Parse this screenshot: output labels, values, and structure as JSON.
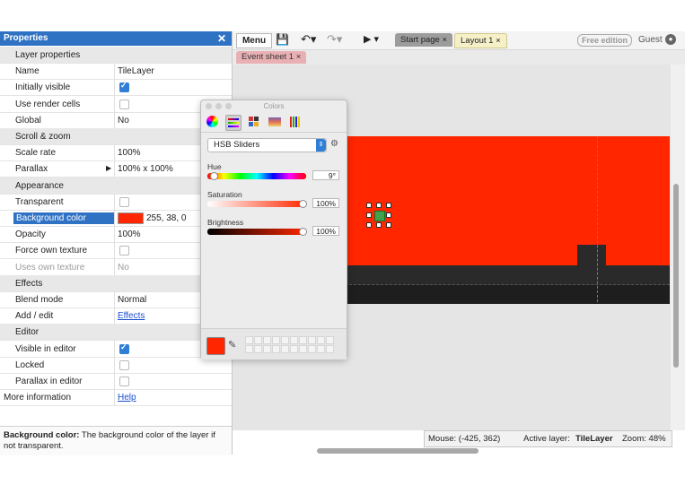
{
  "properties": {
    "title": "Properties",
    "close": "✕",
    "rows": [
      {
        "type": "section",
        "label": "Layer properties"
      },
      {
        "type": "text",
        "label": "Name",
        "value": "TileLayer"
      },
      {
        "type": "check",
        "label": "Initially visible",
        "checked": true
      },
      {
        "type": "check",
        "label": "Use render cells",
        "checked": false
      },
      {
        "type": "text",
        "label": "Global",
        "value": "No"
      },
      {
        "type": "section",
        "label": "Scroll & zoom"
      },
      {
        "type": "text",
        "label": "Scale rate",
        "value": "100%"
      },
      {
        "type": "text",
        "label": "Parallax",
        "value": "100% x 100%"
      },
      {
        "type": "section",
        "label": "Appearance"
      },
      {
        "type": "check",
        "label": "Transparent",
        "checked": false
      },
      {
        "type": "color",
        "label": "Background color",
        "value": "255, 38, 0"
      },
      {
        "type": "text",
        "label": "Opacity",
        "value": "100%"
      },
      {
        "type": "check",
        "label": "Force own texture",
        "checked": false
      },
      {
        "type": "text",
        "label": "Uses own texture",
        "value": "No"
      },
      {
        "type": "section",
        "label": "Effects"
      },
      {
        "type": "text",
        "label": "Blend mode",
        "value": "Normal"
      },
      {
        "type": "link",
        "label": "Add / edit",
        "value": "Effects"
      },
      {
        "type": "section",
        "label": "Editor"
      },
      {
        "type": "check",
        "label": "Visible in editor",
        "checked": true
      },
      {
        "type": "check",
        "label": "Locked",
        "checked": false
      },
      {
        "type": "check",
        "label": "Parallax in editor",
        "checked": false
      },
      {
        "type": "link",
        "label": "More information",
        "value": "Help"
      }
    ],
    "description_bold": "Background color:",
    "description_text": " The background color of the layer if not transparent."
  },
  "toolbar": {
    "menu_label": "Menu",
    "tabs": [
      "Start page",
      "Layout 1"
    ],
    "free_edition": "Free edition",
    "guest": "Guest",
    "sub_tab": "Event sheet 1"
  },
  "colors_dialog": {
    "title": "Colors",
    "mode": "HSB Sliders",
    "hue_label": "Hue",
    "hue_value": "9°",
    "saturation_label": "Saturation",
    "saturation_value": "100%",
    "brightness_label": "Brightness",
    "brightness_value": "100%",
    "hue_fraction": 0.025,
    "saturation_fraction": 1.0,
    "brightness_fraction": 1.0
  },
  "status": {
    "mouse": "Mouse: (-425, 362)",
    "active_layer_label": "Active layer:",
    "active_layer": "TileLayer",
    "zoom": "Zoom: 48%"
  },
  "colors": {
    "background": "#ff2600",
    "accent": "#2f72c4"
  }
}
